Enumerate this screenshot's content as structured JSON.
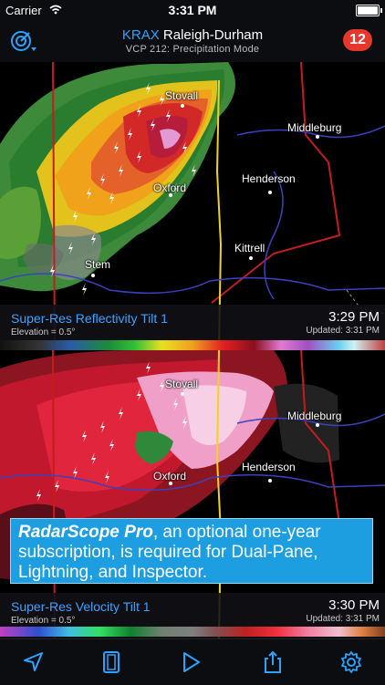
{
  "status_bar": {
    "carrier": "Carrier",
    "time": "3:31 PM"
  },
  "nav": {
    "radar_code": "KRAX",
    "radar_name": "Raleigh-Durham",
    "subtitle": "VCP 212: Precipitation Mode",
    "badge_count": "12",
    "radar_icon": "radar-target-icon"
  },
  "top_pane": {
    "product": "Super-Res Reflectivity Tilt 1",
    "elevation": "Elevation = 0.5°",
    "time": "3:29 PM",
    "updated": "Updated:  3:31 PM",
    "cities": [
      "Stovall",
      "Middleburg",
      "Henderson",
      "Oxford",
      "Kittrell",
      "Stem"
    ]
  },
  "bottom_pane": {
    "product": "Super-Res Velocity Tilt 1",
    "elevation": "Elevation = 0.5°",
    "time": "3:30 PM",
    "updated": "Updated:  3:31 PM",
    "cities": [
      "Stovall",
      "Middleburg",
      "Henderson",
      "Oxford"
    ]
  },
  "promo": {
    "brand": "RadarScope Pro",
    "text": ", an optional one-year subscription, is required for Dual-Pane, Lightning, and Inspector."
  },
  "toolbar": {
    "icons": [
      "location-arrow-icon",
      "layout-icon",
      "play-icon",
      "share-icon",
      "settings-gear-icon"
    ]
  },
  "colors": {
    "accent": "#2aa3ff",
    "badge": "#e5372c",
    "promo": "#1d9ee0"
  }
}
